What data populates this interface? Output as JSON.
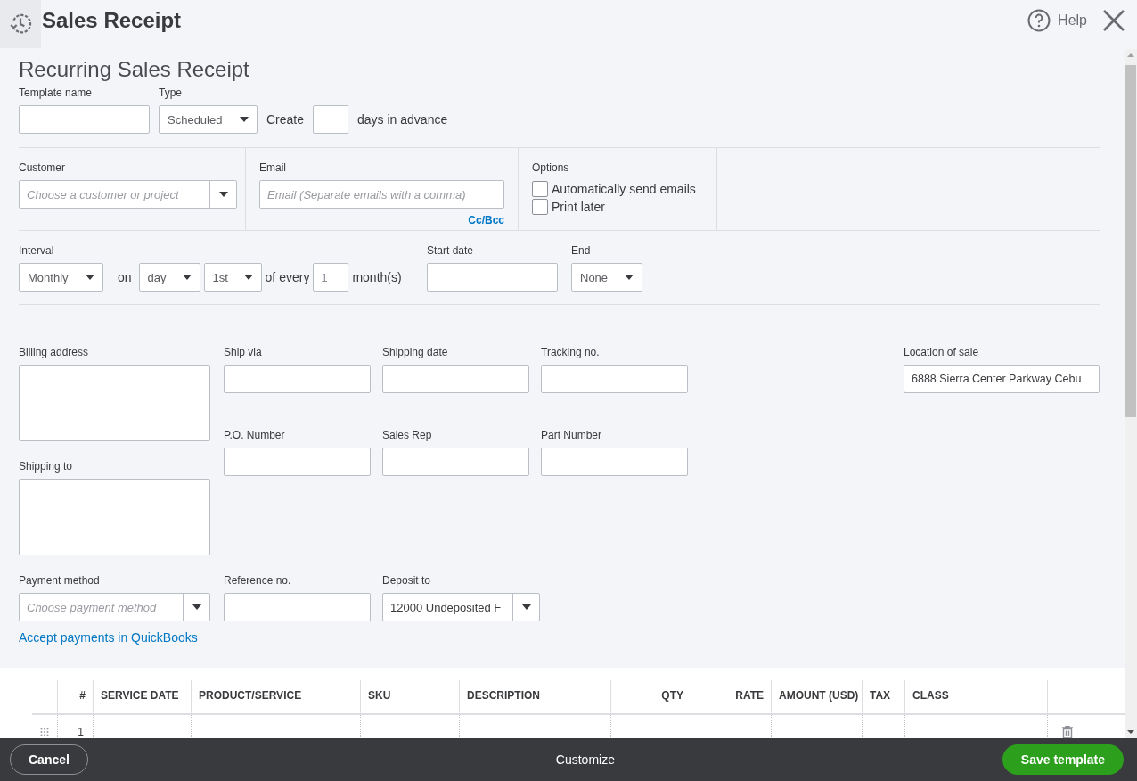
{
  "header": {
    "title": "Sales Receipt",
    "help": "Help"
  },
  "form_title": "Recurring Sales Receipt",
  "template": {
    "name_label": "Template name",
    "type_label": "Type",
    "type_value": "Scheduled",
    "create_label": "Create",
    "advance_label": "days in advance"
  },
  "customer": {
    "label": "Customer",
    "placeholder": "Choose a customer or project"
  },
  "email": {
    "label": "Email",
    "placeholder": "Email (Separate emails with a comma)",
    "link": "Cc/Bcc"
  },
  "options": {
    "label": "Options",
    "items": [
      {
        "label": "Automatically send emails",
        "checked": false
      },
      {
        "label": "Print later",
        "checked": false
      }
    ]
  },
  "interval": {
    "label": "Interval",
    "value": "Monthly",
    "on_label": "on",
    "day": "day",
    "ordinal": "1st",
    "every_label": "of every",
    "count": "1",
    "unit": "month(s)"
  },
  "start_date": {
    "label": "Start date"
  },
  "end": {
    "label": "End",
    "value": "None"
  },
  "billing_address": {
    "label": "Billing address"
  },
  "shipping_to": {
    "label": "Shipping to"
  },
  "ship_via": {
    "label": "Ship via"
  },
  "shipping_date": {
    "label": "Shipping date"
  },
  "tracking_no": {
    "label": "Tracking no."
  },
  "po_number": {
    "label": "P.O. Number"
  },
  "sales_rep": {
    "label": "Sales Rep"
  },
  "part_number": {
    "label": "Part Number"
  },
  "location": {
    "label": "Location of sale",
    "value": "6888 Sierra Center Parkway Cebu"
  },
  "payment_method": {
    "label": "Payment method",
    "placeholder": "Choose payment method"
  },
  "reference_no": {
    "label": "Reference no."
  },
  "deposit_to": {
    "label": "Deposit to",
    "value": "12000 Undeposited F"
  },
  "accept_link": "Accept payments in QuickBooks",
  "table": {
    "columns": [
      "#",
      "SERVICE DATE",
      "PRODUCT/SERVICE",
      "SKU",
      "DESCRIPTION",
      "QTY",
      "RATE",
      "AMOUNT (USD)",
      "TAX",
      "CLASS"
    ],
    "rows": [
      {
        "number": "1"
      }
    ]
  },
  "footer": {
    "cancel": "Cancel",
    "customize": "Customize",
    "save": "Save template"
  }
}
